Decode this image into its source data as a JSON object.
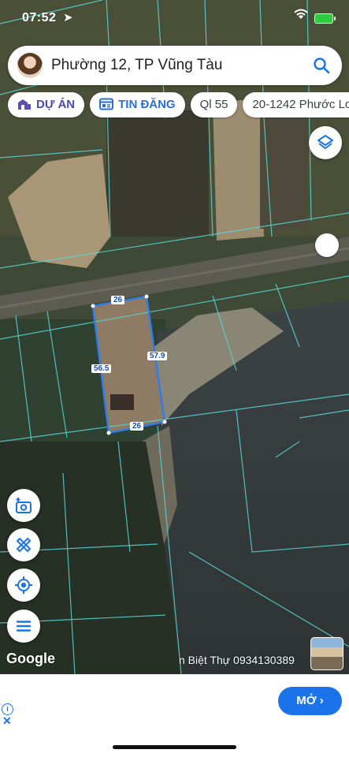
{
  "status": {
    "time": "07:52"
  },
  "search": {
    "query": "Phường 12, TP Vũng Tàu"
  },
  "chips": {
    "project": "DỰ ÁN",
    "listing": "TIN ĐĂNG",
    "road": "Ql 55",
    "parcel": "20-1242 Phước Lo"
  },
  "plot": {
    "top_edge": "26",
    "bottom_edge": "26",
    "left_edge": "56.5",
    "right_edge": "57.9"
  },
  "map": {
    "attribution": "Google",
    "listing_text": "n Biệt Thự 0934130389",
    "icons": [
      "layers-icon",
      "add-photo-icon",
      "measure-ruler-icon",
      "my-location-icon",
      "menu-icon"
    ]
  },
  "ad": {
    "open_label": "MỞ"
  },
  "colors": {
    "accent_blue": "#1a73e8",
    "plot_border": "#2f7de8",
    "parcel_lines": "#59d6d8"
  }
}
